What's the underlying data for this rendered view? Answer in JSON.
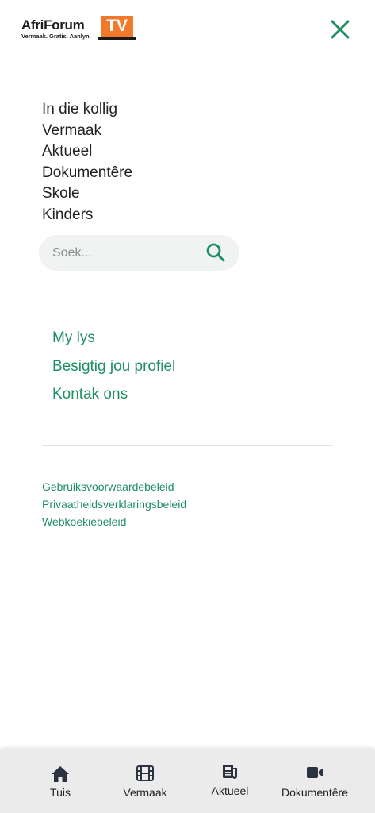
{
  "header": {
    "logo_main": "AfriForum",
    "logo_tv": "TV",
    "logo_tagline": "Vermaak. Gratis. Aanlyn.",
    "close_icon": "close-icon"
  },
  "main_nav": {
    "items": [
      {
        "label": "In die kollig"
      },
      {
        "label": "Vermaak"
      },
      {
        "label": "Aktueel"
      },
      {
        "label": "Dokumentêre"
      },
      {
        "label": "Skole"
      },
      {
        "label": "Kinders"
      }
    ]
  },
  "search": {
    "placeholder": "Soek...",
    "value": "",
    "icon": "search-icon"
  },
  "account_nav": {
    "items": [
      {
        "label": "My lys"
      },
      {
        "label": "Besigtig jou profiel"
      },
      {
        "label": "Kontak ons"
      }
    ]
  },
  "legal_nav": {
    "items": [
      {
        "label": "Gebruiksvoorwaardebeleid"
      },
      {
        "label": "Privaatheidsverklaringsbeleid"
      },
      {
        "label": "Webkoekiebeleid"
      }
    ]
  },
  "bottom_nav": {
    "items": [
      {
        "label": "Tuis",
        "icon": "home-icon"
      },
      {
        "label": "Vermaak",
        "icon": "film-icon"
      },
      {
        "label": "Aktueel",
        "icon": "news-icon"
      },
      {
        "label": "Dokumentêre",
        "icon": "video-camera-icon"
      }
    ]
  },
  "colors": {
    "accent_green": "#1e8e63",
    "brand_orange": "#f0792b",
    "text_dark": "#222222",
    "tabbar_bg": "#ebebeb",
    "search_bg": "#f1f3f2"
  }
}
